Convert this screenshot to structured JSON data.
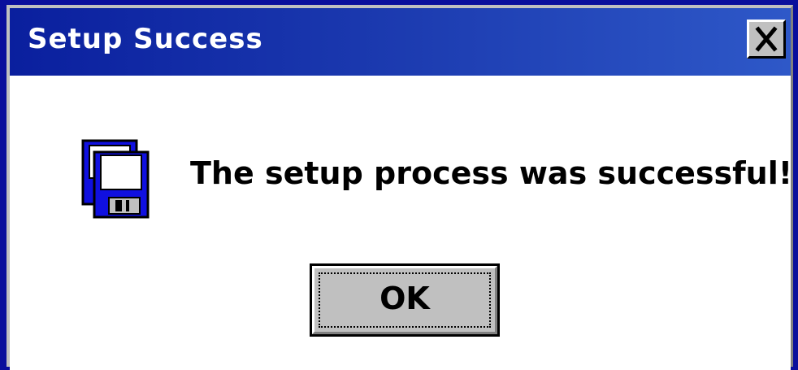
{
  "window": {
    "title": "Setup Success",
    "close_icon": "close-x-icon"
  },
  "dialog": {
    "icon": "floppy-disk-icon",
    "message": "The setup process was successful!",
    "ok_label": "OK"
  },
  "colors": {
    "titlebar_start": "#0a1f9e",
    "titlebar_end": "#2e58c8",
    "button_face": "#c0c0c0",
    "desktop": "#0a0f9c"
  }
}
